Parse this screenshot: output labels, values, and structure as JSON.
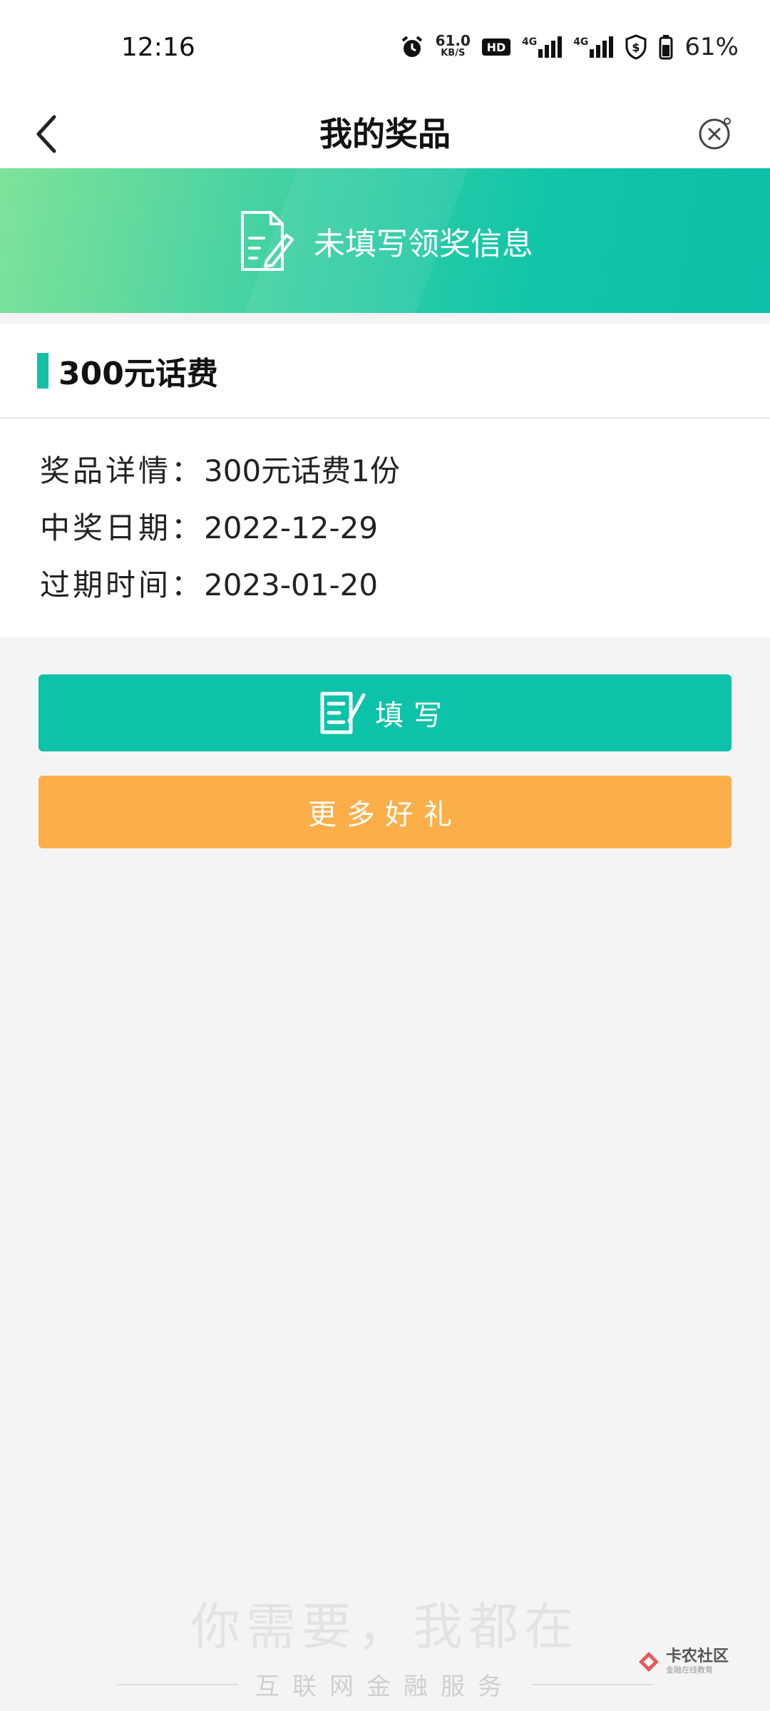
{
  "status_bar": {
    "time": "12:16",
    "net_speed_value": "61.0",
    "net_speed_unit": "KB/S",
    "hd_label": "HD",
    "signal_1_label": "4G",
    "signal_2_label": "4G",
    "battery_percent": "61%"
  },
  "nav": {
    "title": "我的奖品"
  },
  "banner": {
    "text": "未填写领奖信息"
  },
  "prize": {
    "title": "300元话费",
    "rows": [
      {
        "label": "奖品详情：",
        "value": "300元话费1份"
      },
      {
        "label": "中奖日期：",
        "value": "2022-12-29"
      },
      {
        "label": "过期时间：",
        "value": "2023-01-20"
      }
    ]
  },
  "buttons": {
    "fill_label": "填写",
    "more_label": "更多好礼"
  },
  "footer": {
    "slogan": "你需要，我都在",
    "service": "互联网金融服务"
  },
  "watermark": {
    "title": "卡农社区",
    "subtitle": "金融在线教育"
  },
  "colors": {
    "accent": "#0cc2a8",
    "orange": "#fcae48",
    "banner_start": "#7fe29a",
    "banner_end": "#0bbfa8"
  }
}
